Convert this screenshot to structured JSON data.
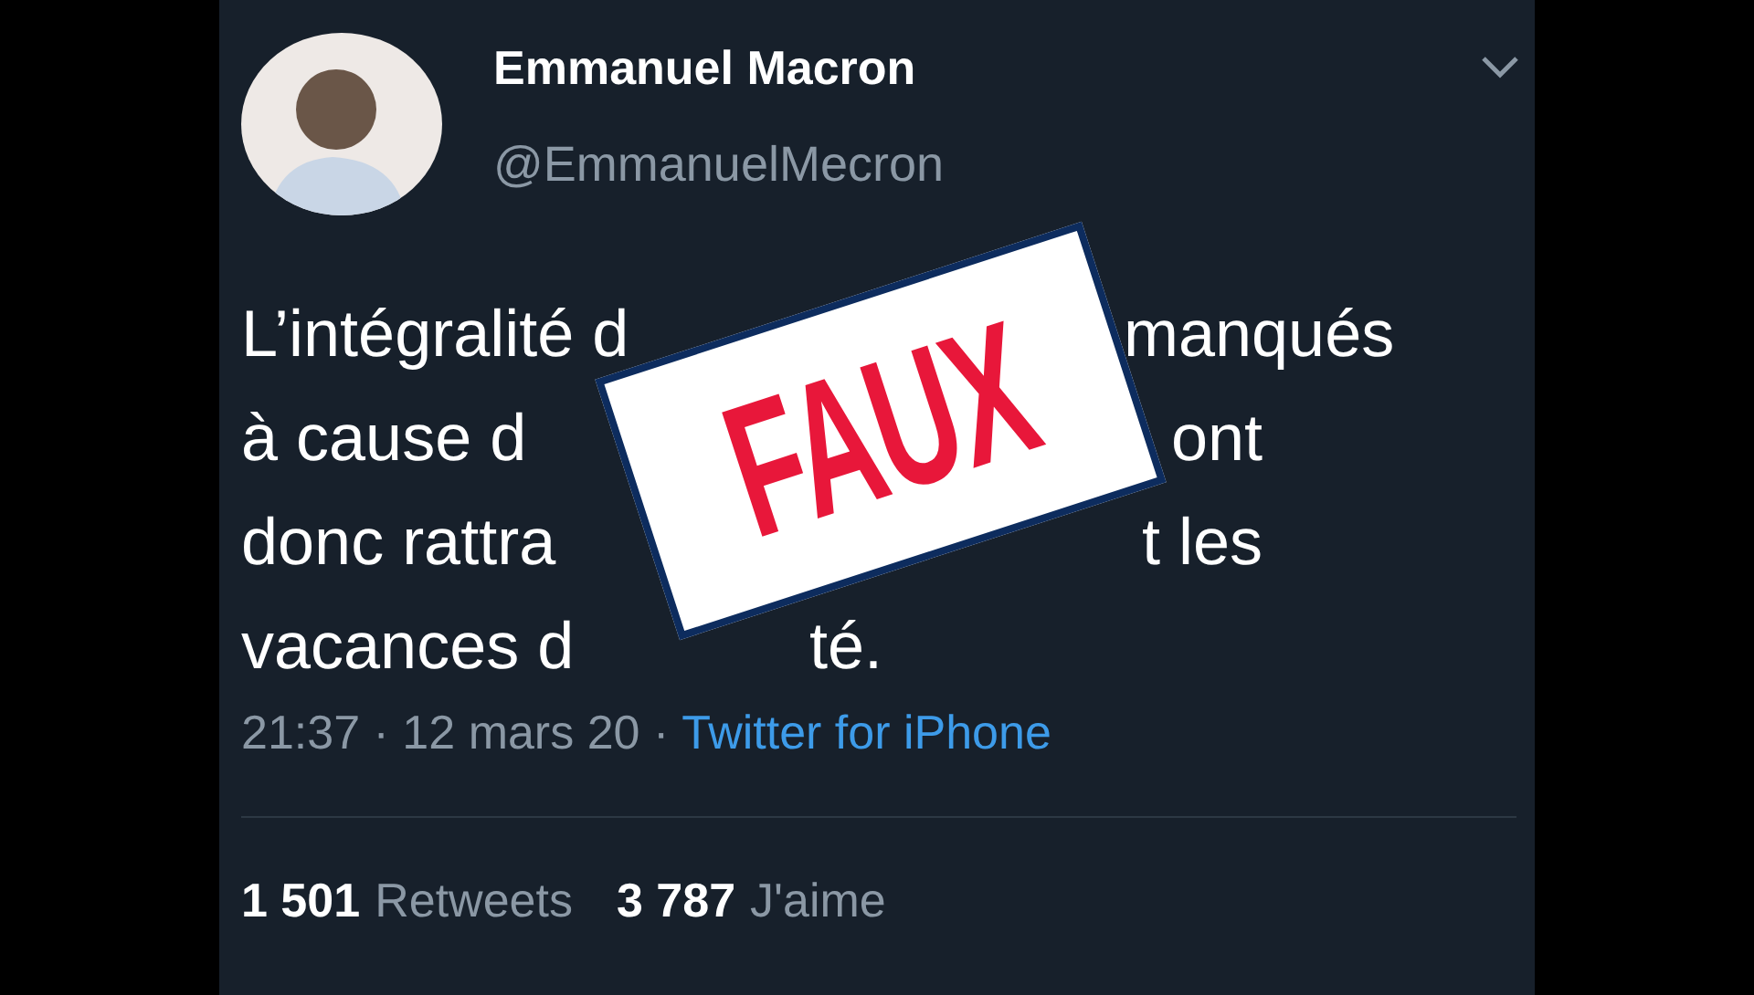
{
  "author": {
    "name": "Emmanuel Macron",
    "handle": "@EmmanuelMecron"
  },
  "tweet_lines": [
    {
      "left": "L’intégralité d",
      "right": "manqués"
    },
    {
      "left": "à cause d",
      "right": "ont"
    },
    {
      "left": "donc rattra",
      "right": "t les"
    },
    {
      "left": "vacances d",
      "right": "té."
    }
  ],
  "meta": {
    "time": "21:37 · 12 mars 20 ·",
    "source": "Twitter for iPhone"
  },
  "stats": [
    {
      "count": "1 501",
      "label": "Retweets"
    },
    {
      "count": "3 787",
      "label": "J'aime"
    }
  ],
  "stamp": {
    "text": "FAUX"
  }
}
